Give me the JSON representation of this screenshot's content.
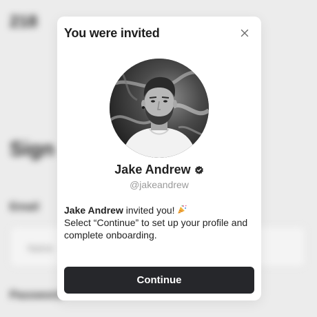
{
  "background": {
    "top_text": "218",
    "heading": "Sign",
    "label_1": "Email",
    "field_text": "Name",
    "label_2": "Password"
  },
  "modal": {
    "title": "You were invited",
    "close_icon": "close-icon",
    "avatar_icon": "profile-photo",
    "user": {
      "name": "Jake Andrew",
      "verified_icon": "verified-badge-icon",
      "handle": "@jakeandrew"
    },
    "message": {
      "inviter": "Jake Andrew",
      "invited_text": "invited you!",
      "party_icon": "party-popper-icon",
      "instructions": "Select “Continue” to set up your profile and complete onboarding."
    },
    "continue_label": "Continue"
  },
  "colors": {
    "button_bg": "#26272b",
    "handle_text": "#9a9a9a",
    "backdrop": "#ececec"
  }
}
